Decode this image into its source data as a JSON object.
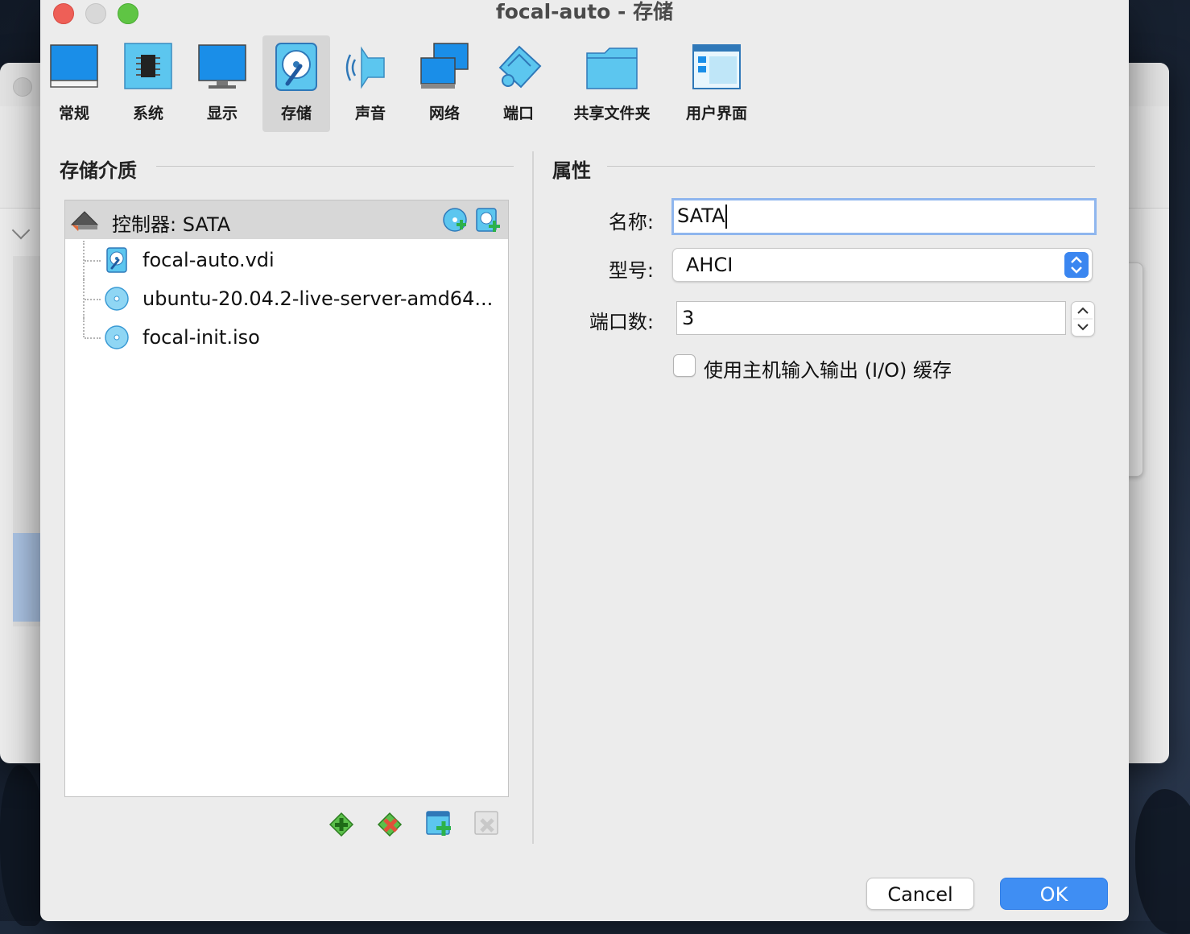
{
  "window": {
    "title": "focal-auto - 存储"
  },
  "toolbar": {
    "items": [
      {
        "label": "常规",
        "icon": "general-monitor-icon"
      },
      {
        "label": "系统",
        "icon": "system-chip-icon"
      },
      {
        "label": "显示",
        "icon": "display-monitor-icon"
      },
      {
        "label": "存储",
        "icon": "storage-disk-icon"
      },
      {
        "label": "声音",
        "icon": "audio-speaker-icon"
      },
      {
        "label": "网络",
        "icon": "network-icon"
      },
      {
        "label": "端口",
        "icon": "serial-port-icon"
      },
      {
        "label": "共享文件夹",
        "icon": "shared-folder-icon"
      },
      {
        "label": "用户界面",
        "icon": "user-interface-icon"
      }
    ],
    "active": "存储"
  },
  "storage": {
    "header": "存储介质",
    "controller": {
      "label": "控制器: SATA"
    },
    "items": [
      {
        "label": "focal-auto.vdi",
        "icon": "hard-disk-icon"
      },
      {
        "label": "ubuntu-20.04.2-live-server-amd64...",
        "icon": "optical-disc-icon"
      },
      {
        "label": "focal-init.iso",
        "icon": "optical-disc-icon"
      }
    ]
  },
  "properties": {
    "header": "属性",
    "name_label": "名称:",
    "name_value": "SATA",
    "type_label": "型号:",
    "type_value": "AHCI",
    "ports_label": "端口数:",
    "ports_value": "3",
    "host_io_label": "使用主机输入输出 (I/O) 缓存",
    "host_io_checked": false
  },
  "buttons": {
    "cancel": "Cancel",
    "ok": "OK"
  },
  "colors": {
    "accent": "#3f8ef3",
    "selection": "#d7d7d7",
    "close": "#ee5f57",
    "maximize": "#5fc544"
  }
}
